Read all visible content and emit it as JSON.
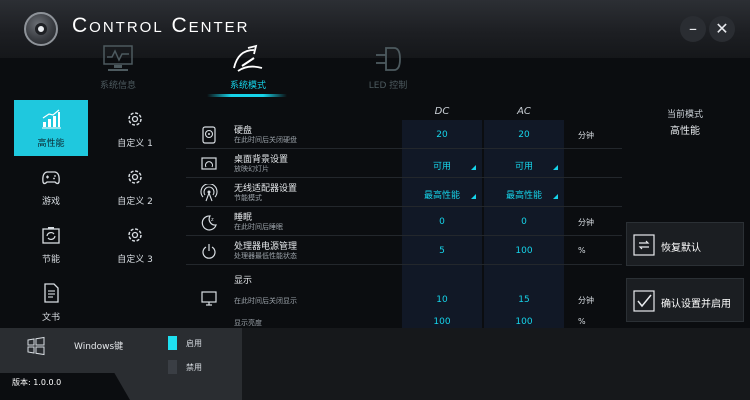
{
  "app": {
    "title": "Control Center"
  },
  "window": {
    "minimize": "–",
    "close": "✕"
  },
  "tabs": [
    {
      "label": "系统信息",
      "icon": "monitor-chart-icon",
      "active": false
    },
    {
      "label": "系统模式",
      "icon": "performance-gauge-icon",
      "active": true
    },
    {
      "label": "LED 控制",
      "icon": "led-icon",
      "active": false
    }
  ],
  "modes": [
    {
      "label": "高性能",
      "icon": "bar-chart-icon",
      "active": true
    },
    {
      "label": "自定义 1",
      "icon": "gear-icon",
      "active": false
    },
    {
      "label": "游戏",
      "icon": "gamepad-icon",
      "active": false
    },
    {
      "label": "自定义 2",
      "icon": "gear-icon",
      "active": false
    },
    {
      "label": "节能",
      "icon": "battery-refresh-icon",
      "active": false
    },
    {
      "label": "自定义 3",
      "icon": "gear-icon",
      "active": false
    },
    {
      "label": "文书",
      "icon": "document-icon",
      "active": false
    }
  ],
  "columns": {
    "dc": "DC",
    "ac": "AC"
  },
  "settings": [
    {
      "name": "硬盘",
      "desc": "在此时间后关闭硬盘",
      "icon": "hard-disk-icon",
      "dc": "20",
      "ac": "20",
      "unit": "分钟",
      "dropdown": false
    },
    {
      "name": "桌面背景设置",
      "desc": "放映幻灯片",
      "icon": "slideshow-icon",
      "dc": "可用",
      "ac": "可用",
      "unit": "",
      "dropdown": true
    },
    {
      "name": "无线适配器设置",
      "desc": "节能模式",
      "icon": "wireless-icon",
      "dc": "最高性能",
      "ac": "最高性能",
      "unit": "",
      "dropdown": true
    },
    {
      "name": "睡眠",
      "desc": "在此时间后睡眠",
      "icon": "sleep-icon",
      "dc": "0",
      "ac": "0",
      "unit": "分钟",
      "dropdown": false
    },
    {
      "name": "处理器电源管理",
      "desc": "处理器最低性能状态",
      "icon": "processor-power-icon",
      "dc": "5",
      "ac": "100",
      "unit": "%",
      "dropdown": false
    }
  ],
  "display": {
    "name": "显示",
    "icon": "display-icon",
    "off_desc": "在此时间后关闭显示",
    "off_dc": "10",
    "off_ac": "15",
    "off_unit": "分钟",
    "brightness_desc": "显示亮度",
    "brightness_dc": "100",
    "brightness_ac": "100",
    "brightness_unit": "%"
  },
  "current_mode": {
    "title": "当前模式",
    "value": "高性能"
  },
  "actions": {
    "restore": "恢复默认",
    "apply": "确认设置并启用"
  },
  "windows_key": {
    "label": "Windows键",
    "enable": "启用",
    "disable": "禁用",
    "enabled": true
  },
  "version": "版本: 1.0.0.0",
  "colors": {
    "accent": "#16d4ea",
    "active_tile": "#1fc8de",
    "background": "#0b0d10"
  }
}
